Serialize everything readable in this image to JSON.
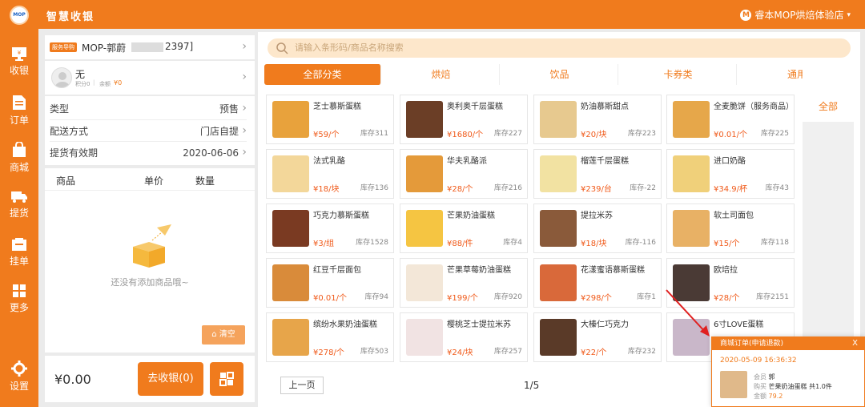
{
  "app": {
    "logo_text": "MOP",
    "title": "智慧收银",
    "user_initial": "M",
    "user_name": "睿本MOP烘焙体验店",
    "user_caret": "▾"
  },
  "sidebar": [
    {
      "label": "收银",
      "icon": "monitor-icon"
    },
    {
      "label": "订单",
      "icon": "document-icon"
    },
    {
      "label": "商城",
      "icon": "shopping-bag-icon"
    },
    {
      "label": "提货",
      "icon": "truck-icon"
    },
    {
      "label": "挂单",
      "icon": "pending-icon"
    },
    {
      "label": "更多",
      "icon": "grid-icon"
    },
    {
      "label": "设置",
      "icon": "gear-icon"
    }
  ],
  "guide": {
    "tag": "服务导购",
    "text": "MOP-郭蔚",
    "id_suffix": "2397]"
  },
  "member": {
    "name": "无",
    "points": "积分0",
    "sep": "|",
    "balance": "余额",
    "balance_value": "¥0"
  },
  "order_fields": [
    {
      "label": "类型",
      "value": "预售"
    },
    {
      "label": "配送方式",
      "value": "门店自提"
    },
    {
      "label": "提货有效期",
      "value": "2020-06-06"
    }
  ],
  "cart": {
    "col_product": "商品",
    "col_price": "单价",
    "col_qty": "数量",
    "empty_text": "还没有添加商品哦~",
    "clear_label": "清空"
  },
  "checkout": {
    "total": "¥0.00",
    "button": "去收银(0)"
  },
  "search": {
    "placeholder": "请输入条形码/商品名称搜索"
  },
  "tabs": [
    "全部分类",
    "烘焙",
    "饮品",
    "卡券类",
    "通用"
  ],
  "side_category": "全部",
  "products": [
    {
      "name": "芝士慕斯蛋糕",
      "price": "¥59/个",
      "stock": "库存311",
      "color": "#e8a23c"
    },
    {
      "name": "奥利奥千层蛋糕",
      "price": "¥1680/个",
      "stock": "库存227",
      "color": "#6b3e26"
    },
    {
      "name": "奶油慕斯甜点",
      "price": "¥20/块",
      "stock": "库存223",
      "color": "#e7c98f"
    },
    {
      "name": "全麦脆饼（服务商品）",
      "price": "¥0.01/个",
      "stock": "库存225",
      "color": "#e6a74a"
    },
    {
      "name": "法式乳酪",
      "price": "¥18/块",
      "stock": "库存136",
      "color": "#f3d79a"
    },
    {
      "name": "华夫乳酪派",
      "price": "¥28/个",
      "stock": "库存216",
      "color": "#e49a3a"
    },
    {
      "name": "榴莲千层蛋糕",
      "price": "¥239/台",
      "stock": "库存-22",
      "color": "#f2e2a2"
    },
    {
      "name": "进口奶酪",
      "price": "¥34.9/杯",
      "stock": "库存43",
      "color": "#f0d07a"
    },
    {
      "name": "巧克力慕斯蛋糕",
      "price": "¥3/组",
      "stock": "库存1528",
      "color": "#7a3a22"
    },
    {
      "name": "芒果奶油蛋糕",
      "price": "¥88/件",
      "stock": "库存4",
      "color": "#f5c542"
    },
    {
      "name": "提拉米苏",
      "price": "¥18/块",
      "stock": "库存-116",
      "color": "#8a5a3a"
    },
    {
      "name": "软土司面包",
      "price": "¥15/个",
      "stock": "库存118",
      "color": "#e8b165"
    },
    {
      "name": "红豆千层面包",
      "price": "¥0.01/个",
      "stock": "库存94",
      "color": "#d98b3a"
    },
    {
      "name": "芒果草莓奶油蛋糕",
      "price": "¥199/个",
      "stock": "库存920",
      "color": "#f3e7d8"
    },
    {
      "name": "花漾蜜语慕斯蛋糕",
      "price": "¥298/个",
      "stock": "库存1",
      "color": "#d9693a"
    },
    {
      "name": "欧培拉",
      "price": "¥28/个",
      "stock": "库存2151",
      "color": "#4a3a35"
    },
    {
      "name": "缤纷水果奶油蛋糕",
      "price": "¥278/个",
      "stock": "库存503",
      "color": "#e7a54a"
    },
    {
      "name": "樱桃芝士提拉米苏",
      "price": "¥24/块",
      "stock": "库存257",
      "color": "#f1e3e3"
    },
    {
      "name": "大榛仁巧克力",
      "price": "¥22/个",
      "stock": "库存232",
      "color": "#5a3a28"
    },
    {
      "name": "6寸LOVE蛋糕",
      "price": "",
      "stock": "",
      "color": "#c9b7c9"
    }
  ],
  "pager": {
    "prev": "上一页",
    "page": "1/5"
  },
  "popup": {
    "title": "商城订单(申请退款)",
    "close": "X",
    "time": "2020-05-09 16:36:32",
    "member_label": "会员",
    "member": "郭",
    "buy_label": "购买",
    "buy": "芒果奶油蛋糕 共1.0件",
    "amount_label": "金额",
    "amount": "79.2"
  }
}
